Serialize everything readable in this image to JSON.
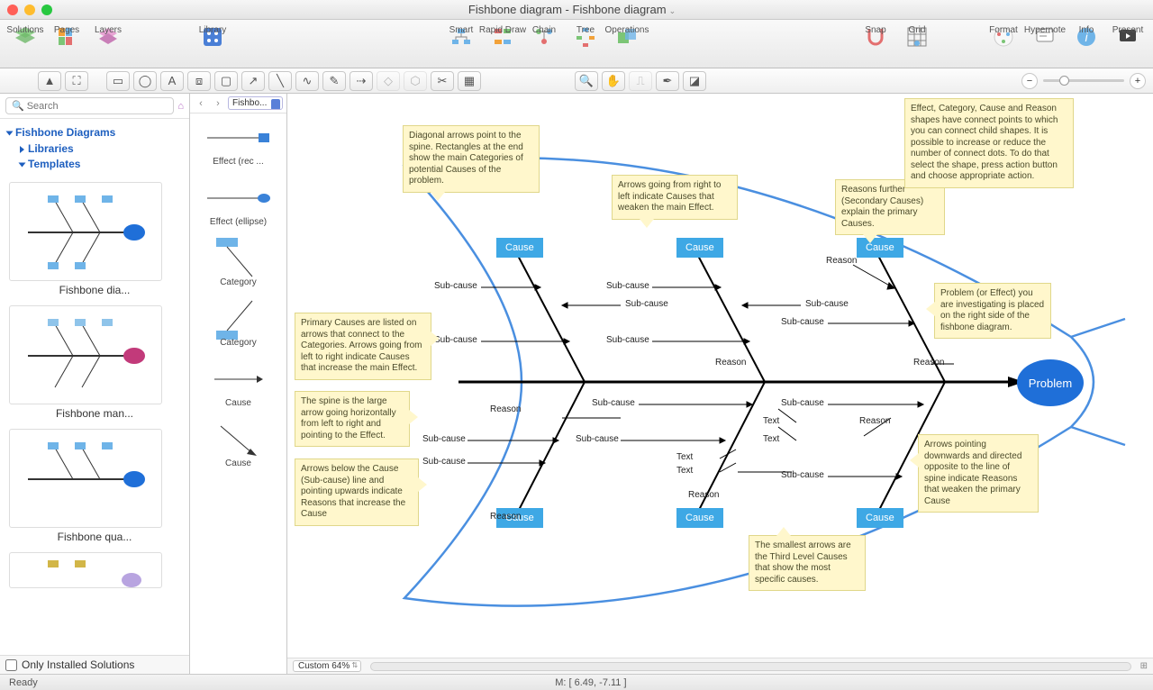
{
  "window": {
    "title": "Fishbone diagram - Fishbone diagram"
  },
  "toolbar": {
    "solutions": "Solutions",
    "pages": "Pages",
    "layers": "Layers",
    "library": "Library",
    "smart": "Smart",
    "rapid": "Rapid Draw",
    "chain": "Chain",
    "tree": "Tree",
    "operations": "Operations",
    "snap": "Snap",
    "grid": "Grid",
    "format": "Format",
    "hypernote": "Hypernote",
    "info": "Info",
    "present": "Present"
  },
  "search": {
    "placeholder": "Search"
  },
  "nav": {
    "root": "Fishbone Diagrams",
    "libraries": "Libraries",
    "templates": "Templates"
  },
  "templates": [
    {
      "label": "Fishbone dia..."
    },
    {
      "label": "Fishbone man..."
    },
    {
      "label": "Fishbone qua..."
    }
  ],
  "only_installed": "Only Installed Solutions",
  "libselector": "Fishbo...",
  "libitems": [
    {
      "label": "Effect (rec ..."
    },
    {
      "label": "Effect (ellipse)"
    },
    {
      "label": "Category"
    },
    {
      "label": "Category"
    },
    {
      "label": "Cause"
    },
    {
      "label": "Cause"
    }
  ],
  "diagram": {
    "problem": "Problem",
    "cause": "Cause",
    "subcause": "Sub-cause",
    "reason": "Reason",
    "text": "Text",
    "notes": {
      "diag": "Diagonal arrows point to the spine. Rectangles at the end show the main Categories of potential Causes of the problem.",
      "rtl": "Arrows going from right to left indicate Causes that weaken the main Effect.",
      "reasons": "Reasons further (Secondary Causes) explain the primary Causes.",
      "connect": "Effect, Category, Cause and Reason shapes have connect points to which you can connect child shapes. It is possible to increase or reduce the number of connect dots. To do that select the shape, press action button and choose appropriate action.",
      "primary": "Primary Causes are listed on arrows that connect to the Categories. Arrows going from left to right indicate Causes that increase the main Effect.",
      "spine": "The spine is the large arrow going horizontally from left to right and pointing to the Effect.",
      "below": "Arrows below the Cause (Sub-cause) line and pointing upwards indicate Reasons that increase the Cause",
      "problem": "Problem (or Effect) you are investigating is placed on the right side of the fishbone diagram.",
      "down": "Arrows pointing downwards and directed opposite to the line of spine indicate Reasons that weaken the primary Cause",
      "smallest": "The smallest arrows are the Third Level Causes that show the most specific causes."
    }
  },
  "zoom": {
    "label": "Custom 64%"
  },
  "status": {
    "ready": "Ready",
    "coords": "M: [ 6.49, -7.11 ]"
  }
}
